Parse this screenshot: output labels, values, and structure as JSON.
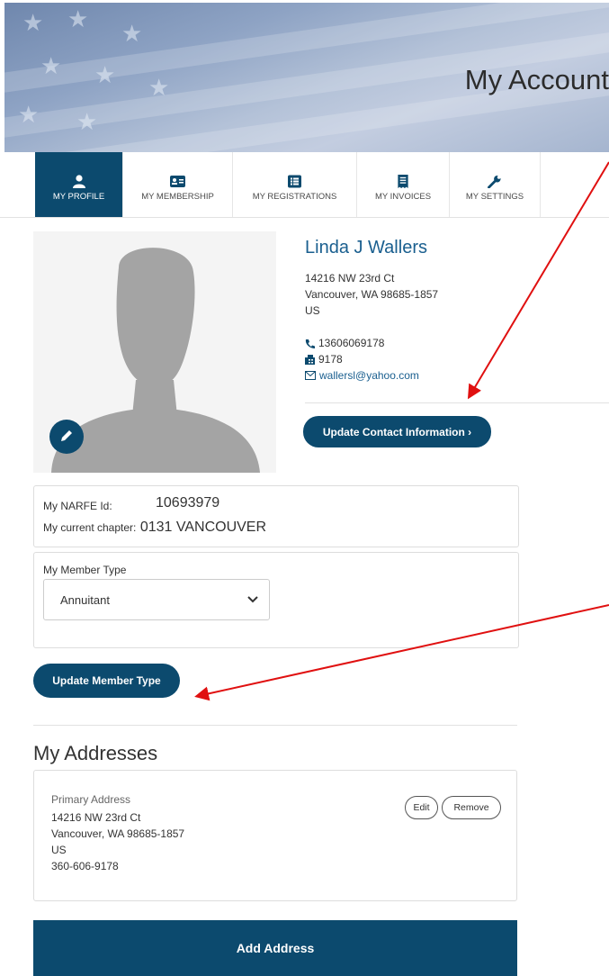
{
  "banner": {
    "title": "My Account"
  },
  "tabs": [
    {
      "label": "MY PROFILE",
      "icon": "user-icon",
      "active": true
    },
    {
      "label": "MY MEMBERSHIP",
      "icon": "id-card-icon",
      "active": false
    },
    {
      "label": "MY REGISTRATIONS",
      "icon": "list-icon",
      "active": false
    },
    {
      "label": "MY INVOICES",
      "icon": "receipt-icon",
      "active": false
    },
    {
      "label": "MY SETTINGS",
      "icon": "wrench-icon",
      "active": false
    }
  ],
  "profile": {
    "name": "Linda J Wallers",
    "address_line1": "14216 NW 23rd Ct",
    "address_line2": "Vancouver, WA 98685-1857",
    "country": "US",
    "phone": "13606069178",
    "fax": "9178",
    "email": "wallersl@yahoo.com",
    "update_contact_label": "Update Contact Information ›"
  },
  "member_info": {
    "narfe_id_label": "My NARFE Id:",
    "narfe_id": "10693979",
    "chapter_label": "My current chapter:",
    "chapter": "0131 VANCOUVER"
  },
  "member_type": {
    "label": "My Member Type",
    "selected": "Annuitant",
    "update_label": "Update Member Type"
  },
  "addresses": {
    "title": "My Addresses",
    "items": [
      {
        "type_label": "Primary Address",
        "line1": "14216 NW 23rd Ct",
        "line2": "Vancouver, WA 98685-1857",
        "country": "US",
        "phone": "360-606-9178",
        "edit_label": "Edit",
        "remove_label": "Remove"
      }
    ],
    "add_label": "Add Address"
  },
  "colors": {
    "primary": "#0c4a6e",
    "link": "#1a5f8f",
    "annotation_arrow": "#e01010"
  }
}
